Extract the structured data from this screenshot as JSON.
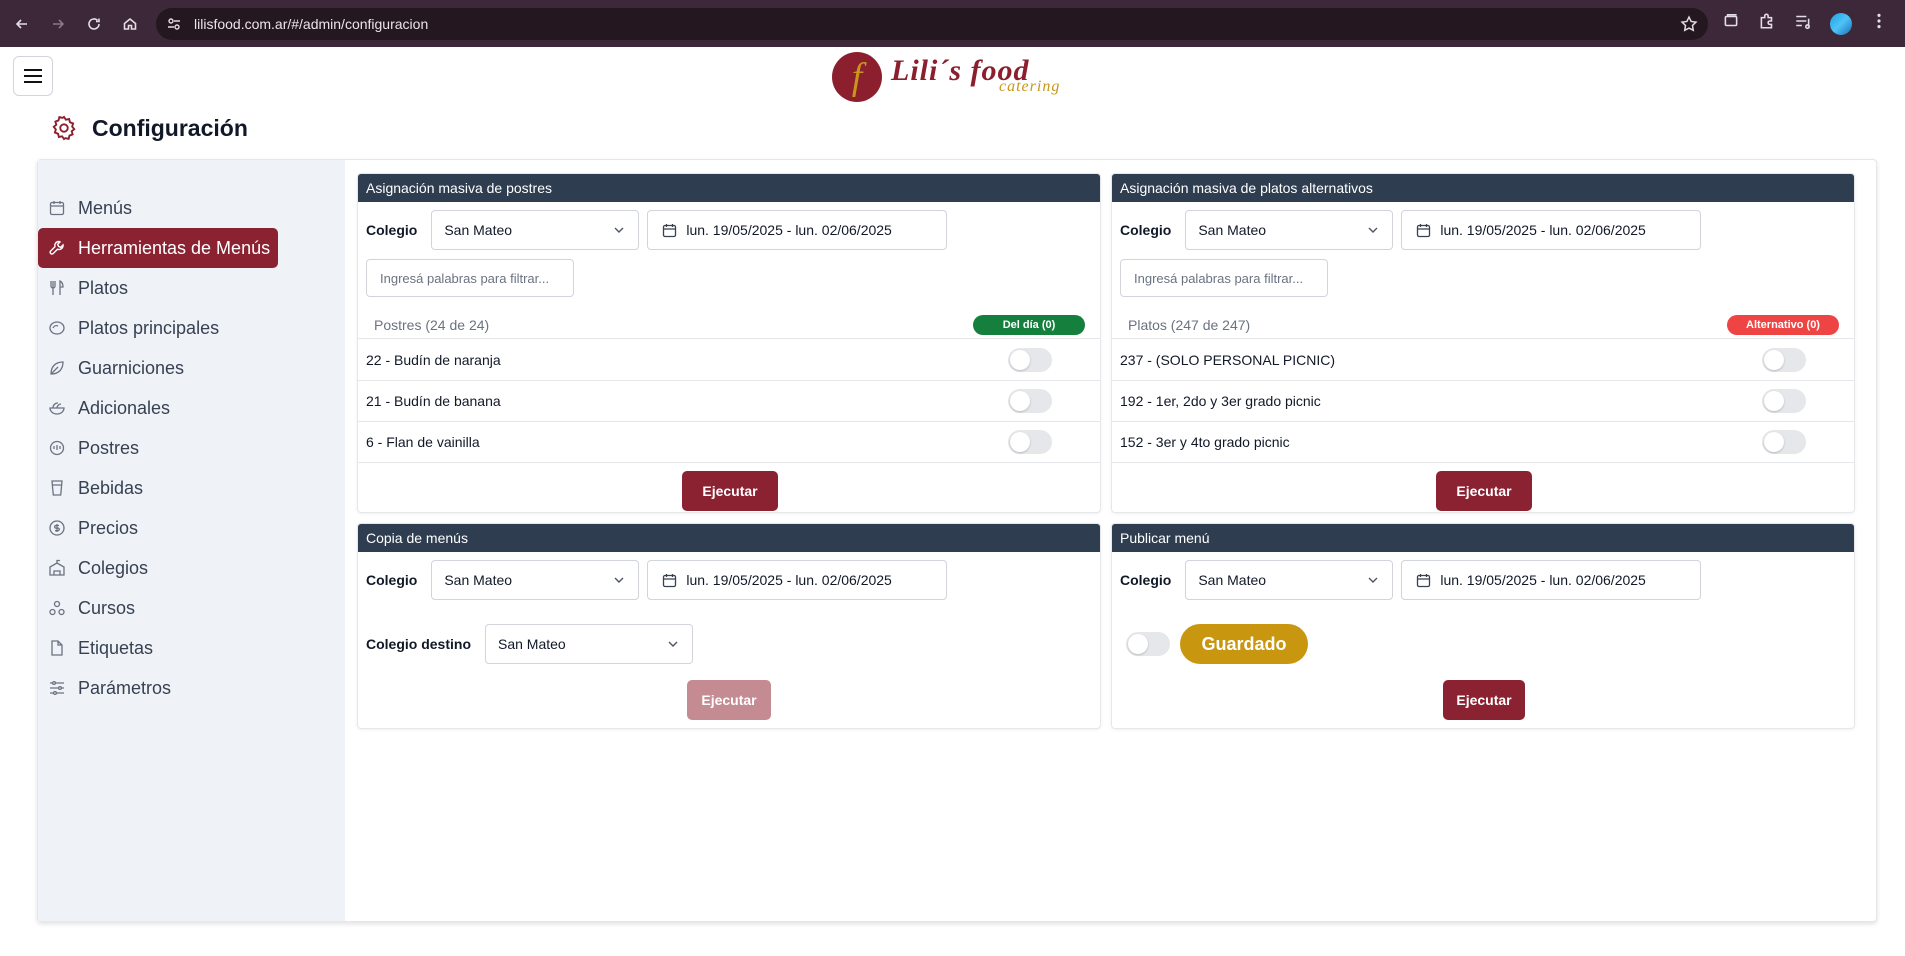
{
  "browser": {
    "url": "lilisfood.com.ar/#/admin/configuracion"
  },
  "brand": {
    "name": "Lili´s food",
    "sub": "catering",
    "mark_letter": "f"
  },
  "page": {
    "title": "Configuración"
  },
  "sidebar": {
    "items": [
      {
        "label": "Menús",
        "icon": "calendar-icon"
      },
      {
        "label": "Herramientas de Menús",
        "icon": "wrench-icon"
      },
      {
        "label": "Platos",
        "icon": "utensils-icon"
      },
      {
        "label": "Platos principales",
        "icon": "dish-icon"
      },
      {
        "label": "Guarniciones",
        "icon": "leaf-icon"
      },
      {
        "label": "Adicionales",
        "icon": "salad-icon"
      },
      {
        "label": "Postres",
        "icon": "dessert-icon"
      },
      {
        "label": "Bebidas",
        "icon": "cup-icon"
      },
      {
        "label": "Precios",
        "icon": "dollar-icon"
      },
      {
        "label": "Colegios",
        "icon": "school-icon"
      },
      {
        "label": "Cursos",
        "icon": "shapes-icon"
      },
      {
        "label": "Etiquetas",
        "icon": "file-icon"
      },
      {
        "label": "Parámetros",
        "icon": "sliders-icon"
      }
    ]
  },
  "cards": {
    "postres": {
      "title": "Asignación masiva de postres",
      "colegio_label": "Colegio",
      "colegio_value": "San Mateo",
      "date_range": "lun. 19/05/2025 - lun. 02/06/2025",
      "filter_placeholder": "Ingresá palabras para filtrar...",
      "list_count": "Postres (24 de 24)",
      "pill": "Del día (0)",
      "rows": [
        "22 - Budín de naranja",
        "21 - Budín de banana",
        "6 - Flan de vainilla"
      ],
      "button": "Ejecutar"
    },
    "alternativos": {
      "title": "Asignación masiva de platos alternativos",
      "colegio_label": "Colegio",
      "colegio_value": "San Mateo",
      "date_range": "lun. 19/05/2025 - lun. 02/06/2025",
      "filter_placeholder": "Ingresá palabras para filtrar...",
      "list_count": "Platos (247 de 247)",
      "pill": "Alternativo (0)",
      "rows": [
        "237 - (SOLO PERSONAL PICNIC)",
        "192 - 1er, 2do y 3er grado picnic",
        "152 - 3er y 4to grado picnic"
      ],
      "button": "Ejecutar"
    },
    "copia": {
      "title": "Copia de menús",
      "colegio_label": "Colegio",
      "colegio_value": "San Mateo",
      "date_range": "lun. 19/05/2025 - lun. 02/06/2025",
      "destino_label": "Colegio destino",
      "destino_value": "San Mateo",
      "button": "Ejecutar"
    },
    "publicar": {
      "title": "Publicar menú",
      "colegio_label": "Colegio",
      "colegio_value": "San Mateo",
      "date_range": "lun. 19/05/2025 - lun. 02/06/2025",
      "status": "Guardado",
      "button": "Ejecutar"
    }
  },
  "colors": {
    "accent": "#8b2232",
    "header_dark": "#2f3d50",
    "success": "#15803d",
    "danger": "#ef4444",
    "gold": "#c9960f"
  }
}
